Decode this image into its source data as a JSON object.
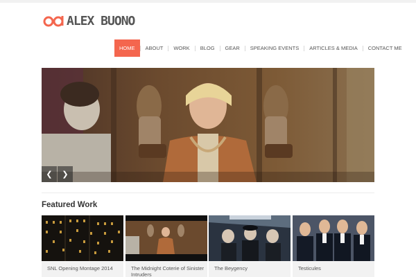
{
  "site": {
    "logo_text": "ALEX BUONO",
    "brand_color": "#f4664e"
  },
  "nav": {
    "items": [
      {
        "label": "HOME"
      },
      {
        "label": "ABOUT"
      },
      {
        "label": "WORK"
      },
      {
        "label": "BLOG"
      },
      {
        "label": "GEAR"
      },
      {
        "label": "SPEAKING EVENTS"
      },
      {
        "label": "ARTICLES & MEDIA"
      },
      {
        "label": "CONTACT ME"
      }
    ],
    "active": "HOME"
  },
  "slider": {
    "prev_icon": "chevron-left-icon",
    "next_icon": "chevron-right-icon"
  },
  "featured": {
    "heading": "Featured Work",
    "items": [
      {
        "title": "SNL Opening Montage 2014"
      },
      {
        "title": "The Midnight Coterie of Sinister Intruders"
      },
      {
        "title": "The Beygency"
      },
      {
        "title": "Testicules"
      }
    ]
  }
}
